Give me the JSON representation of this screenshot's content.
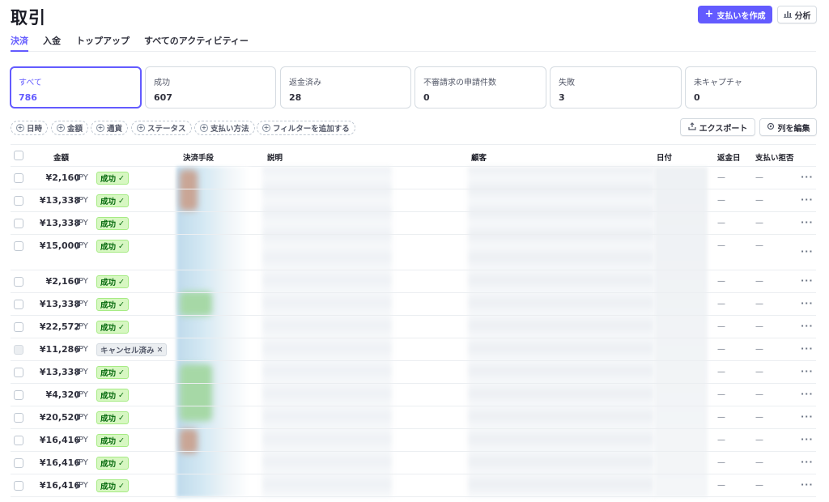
{
  "header": {
    "title": "取引",
    "create_payment_label": "支払いを作成",
    "analysis_label": "分析"
  },
  "tabs": [
    {
      "label": "決済",
      "active": true
    },
    {
      "label": "入金",
      "active": false
    },
    {
      "label": "トップアップ",
      "active": false
    },
    {
      "label": "すべてのアクティビティー",
      "active": false
    }
  ],
  "status_cards": [
    {
      "label": "すべて",
      "count": "786",
      "active": true
    },
    {
      "label": "成功",
      "count": "607",
      "active": false
    },
    {
      "label": "返金済み",
      "count": "28",
      "active": false
    },
    {
      "label": "不審請求の申請件数",
      "count": "0",
      "active": false
    },
    {
      "label": "失敗",
      "count": "3",
      "active": false
    },
    {
      "label": "未キャプチャ",
      "count": "0",
      "active": false
    }
  ],
  "filters": [
    {
      "label": "日時"
    },
    {
      "label": "金額"
    },
    {
      "label": "通貨"
    },
    {
      "label": "ステータス"
    },
    {
      "label": "支払い方法"
    },
    {
      "label": "フィルターを追加する"
    }
  ],
  "toolbar": {
    "export_label": "エクスポート",
    "edit_columns_label": "列を編集"
  },
  "table": {
    "columns": {
      "amount": "金額",
      "payment_method": "決済手段",
      "description": "説明",
      "customer": "顧客",
      "date": "日付",
      "refund_date": "返金日",
      "dispute": "支払い拒否"
    },
    "rows": [
      {
        "amount": "¥2,160",
        "currency": "JPY",
        "status": "成功",
        "status_type": "ok",
        "refund_date": "—",
        "dispute": "—"
      },
      {
        "amount": "¥13,338",
        "currency": "JPY",
        "status": "成功",
        "status_type": "ok",
        "refund_date": "—",
        "dispute": "—"
      },
      {
        "amount": "¥13,338",
        "currency": "JPY",
        "status": "成功",
        "status_type": "ok",
        "refund_date": "—",
        "dispute": "—"
      },
      {
        "amount": "¥15,000",
        "currency": "JPY",
        "status": "成功",
        "status_type": "ok",
        "refund_date": "—",
        "dispute": "—"
      },
      {
        "amount": "¥2,160",
        "currency": "JPY",
        "status": "成功",
        "status_type": "ok",
        "refund_date": "—",
        "dispute": "—"
      },
      {
        "amount": "¥13,338",
        "currency": "JPY",
        "status": "成功",
        "status_type": "ok",
        "refund_date": "—",
        "dispute": "—"
      },
      {
        "amount": "¥22,572",
        "currency": "JPY",
        "status": "成功",
        "status_type": "ok",
        "refund_date": "—",
        "dispute": "—"
      },
      {
        "amount": "¥11,286",
        "currency": "JPY",
        "status": "キャンセル済み",
        "status_type": "cancel",
        "refund_date": "—",
        "dispute": "—"
      },
      {
        "amount": "¥13,338",
        "currency": "JPY",
        "status": "成功",
        "status_type": "ok",
        "refund_date": "—",
        "dispute": "—"
      },
      {
        "amount": "¥4,320",
        "currency": "JPY",
        "status": "成功",
        "status_type": "ok",
        "refund_date": "—",
        "dispute": "—"
      },
      {
        "amount": "¥20,520",
        "currency": "JPY",
        "status": "成功",
        "status_type": "ok",
        "refund_date": "—",
        "dispute": "—"
      },
      {
        "amount": "¥16,416",
        "currency": "JPY",
        "status": "成功",
        "status_type": "ok",
        "refund_date": "—",
        "dispute": "—"
      },
      {
        "amount": "¥16,416",
        "currency": "JPY",
        "status": "成功",
        "status_type": "ok",
        "refund_date": "—",
        "dispute": "—"
      },
      {
        "amount": "¥16,416",
        "currency": "JPY",
        "status": "成功",
        "status_type": "ok",
        "refund_date": "—",
        "dispute": "—"
      }
    ]
  },
  "colors": {
    "accent": "#635bff",
    "success_bg": "#d7f7c2",
    "success_text": "#05690d"
  }
}
